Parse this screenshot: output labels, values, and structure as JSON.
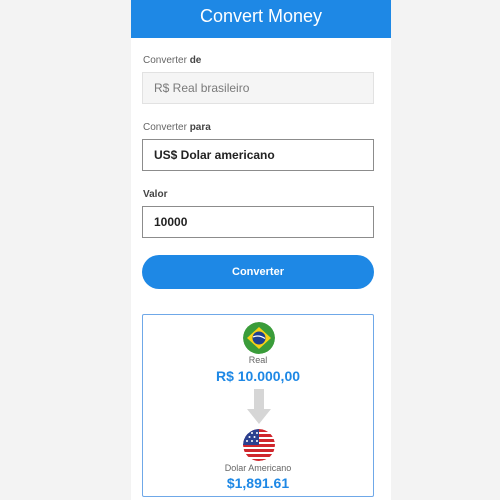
{
  "header": {
    "title": "Convert Money"
  },
  "from_field": {
    "label_prefix": "Converter",
    "label_suffix": "de",
    "value": "R$ Real brasileiro"
  },
  "to_field": {
    "label_prefix": "Converter",
    "label_suffix": "para",
    "value": "US$ Dolar americano"
  },
  "amount_field": {
    "label": "Valor",
    "value": "10000"
  },
  "convert_button": {
    "label": "Converter"
  },
  "result": {
    "from_name": "Real",
    "from_amount": "R$ 10.000,00",
    "from_flag_icon": "brazil-flag-icon",
    "to_name": "Dolar Americano",
    "to_amount": "$1,891.61",
    "to_flag_icon": "usa-flag-icon",
    "arrow_icon": "arrow-down-icon"
  },
  "colors": {
    "primary": "#1e88e5",
    "card_border": "#6fa8e8"
  }
}
